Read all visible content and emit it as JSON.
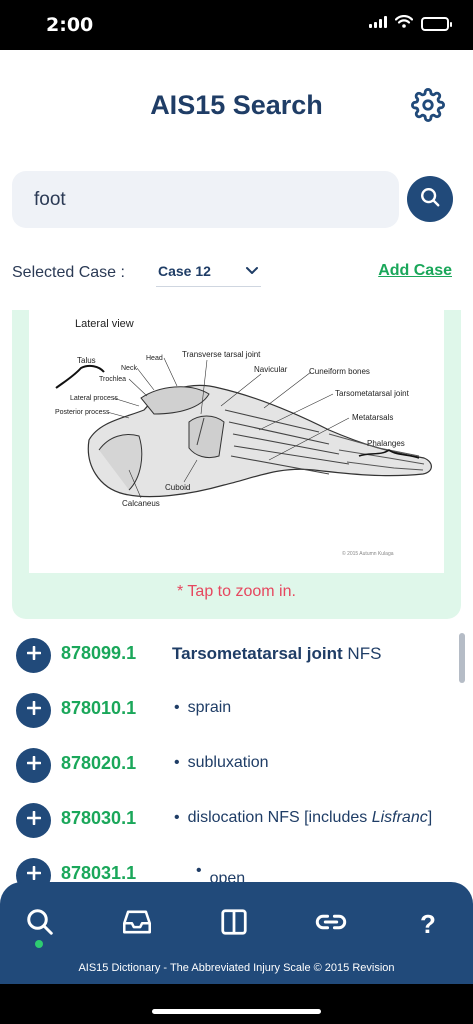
{
  "status": {
    "time": "2:00"
  },
  "header": {
    "title": "AIS15 Search",
    "settings_icon": "gear-icon"
  },
  "search": {
    "value": "foot",
    "button_icon": "search-icon"
  },
  "case": {
    "label": "Selected Case :",
    "value": "Case 12",
    "add_label": "Add Case"
  },
  "image_card": {
    "diagram_labels": {
      "title": "Lateral view",
      "talus": "Talus",
      "head": "Head",
      "neck": "Neck",
      "trochlea": "Trochlea",
      "lateral_process": "Lateral process",
      "posterior_process": "Posterior process",
      "transverse": "Transverse tarsal joint",
      "navicular": "Navicular",
      "cuneiform": "Cuneiform bones",
      "tarsometatarsal": "Tarsometatarsal joint",
      "metatarsals": "Metatarsals",
      "phalanges": "Phalanges",
      "cuboid": "Cuboid",
      "calcaneus": "Calcaneus",
      "credit": "© 2015 Autumn Kulaga"
    },
    "zoom_hint": "* Tap to zoom in."
  },
  "codes": [
    {
      "code": "878099.1",
      "bold": "Tarsometatarsal joint",
      "text": " NFS"
    },
    {
      "code": "878010.1",
      "text": "sprain"
    },
    {
      "code": "878020.1",
      "text": "subluxation"
    },
    {
      "code": "878030.1",
      "text": "dislocation NFS [includes ",
      "italic": "Lisfranc",
      "after": "]"
    },
    {
      "code": "878031.1",
      "text": "open"
    }
  ],
  "tabbar": {
    "tabs": [
      "search-icon",
      "inbox-icon",
      "book-icon",
      "link-icon",
      "help-icon"
    ],
    "help_glyph": "?",
    "footer": "AIS15 Dictionary - The Abbreviated Injury Scale © 2015 Revision"
  }
}
